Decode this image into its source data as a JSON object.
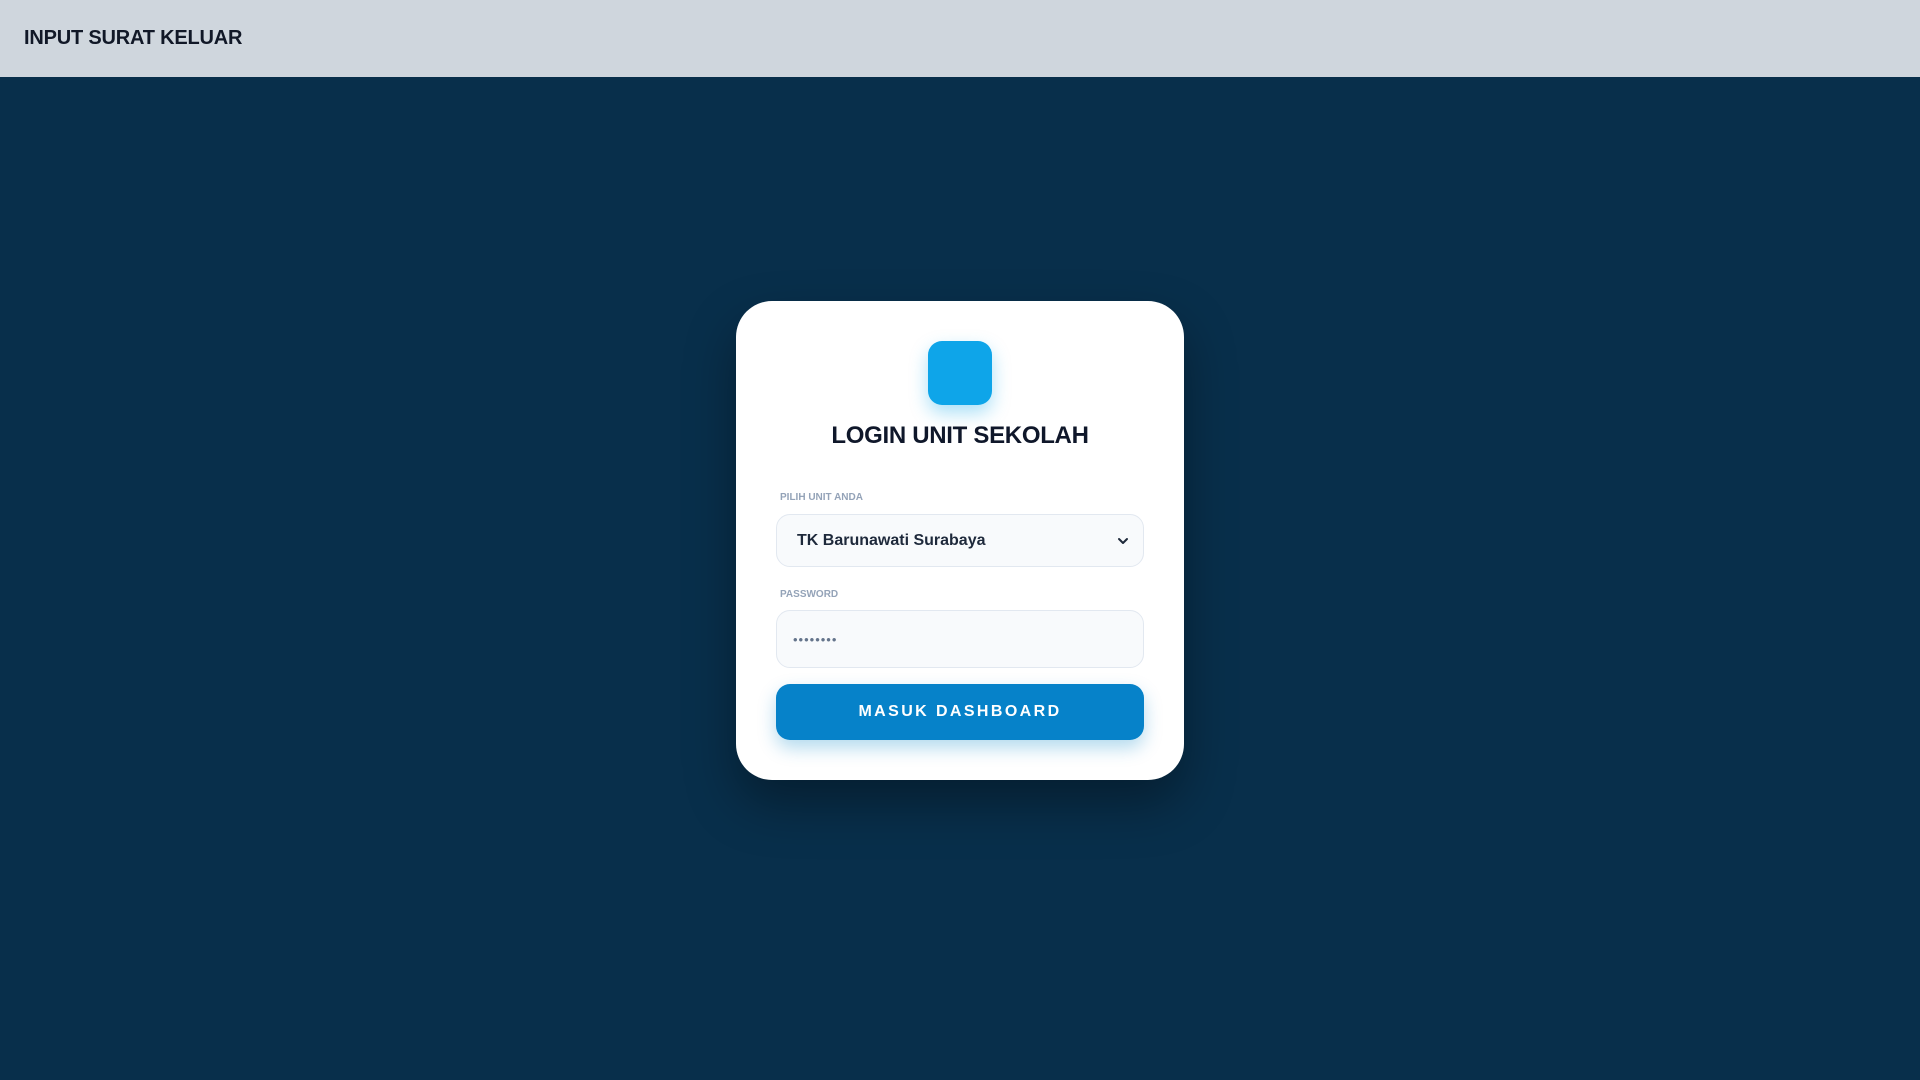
{
  "topbar": {
    "title": "INPUT SURAT KELUAR"
  },
  "login_card": {
    "title": "LOGIN UNIT SEKOLAH",
    "unit_field": {
      "label": "PILIH UNIT ANDA",
      "selected_value": "TK Barunawati Surabaya"
    },
    "password_field": {
      "label": "PASSWORD",
      "value": "••••••••"
    },
    "submit_label": "MASUK DASHBOARD"
  },
  "icons": {
    "logo": "app-logo-icon",
    "select_chevron": "chevron-down-icon"
  },
  "colors": {
    "background": "#082f4b",
    "topbar": "#cfd6dd",
    "logo": "#0ea5e9",
    "button": "#0682c9",
    "card": "#ffffff"
  }
}
